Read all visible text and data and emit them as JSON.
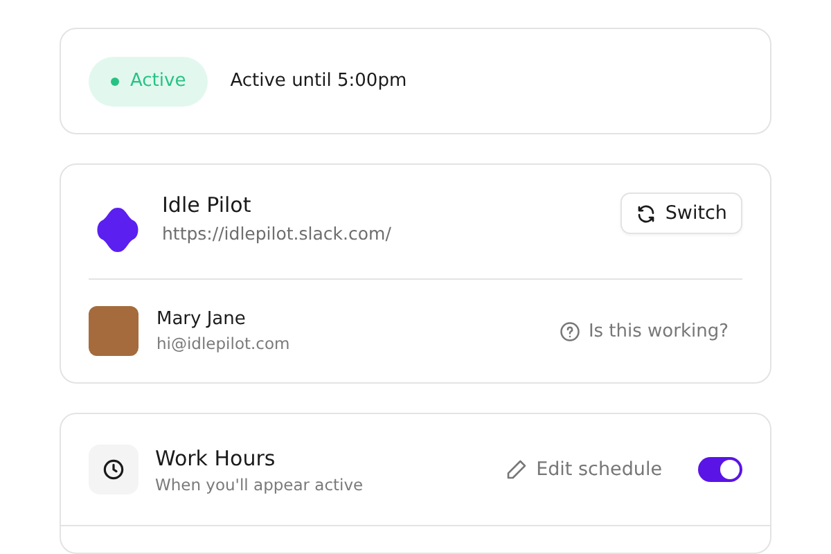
{
  "status": {
    "label": "Active",
    "active": true,
    "detail": "Active until 5:00pm"
  },
  "workspace": {
    "name": "Idle Pilot",
    "url": "https://idlepilot.slack.com/",
    "switch_button": "Switch"
  },
  "user": {
    "name": "Mary Jane",
    "email": "hi@idlepilot.com",
    "help_link": "Is this working?"
  },
  "work_hours": {
    "title": "Work Hours",
    "subtitle": "When you'll appear active",
    "edit_button": "Edit schedule",
    "on": true
  }
}
